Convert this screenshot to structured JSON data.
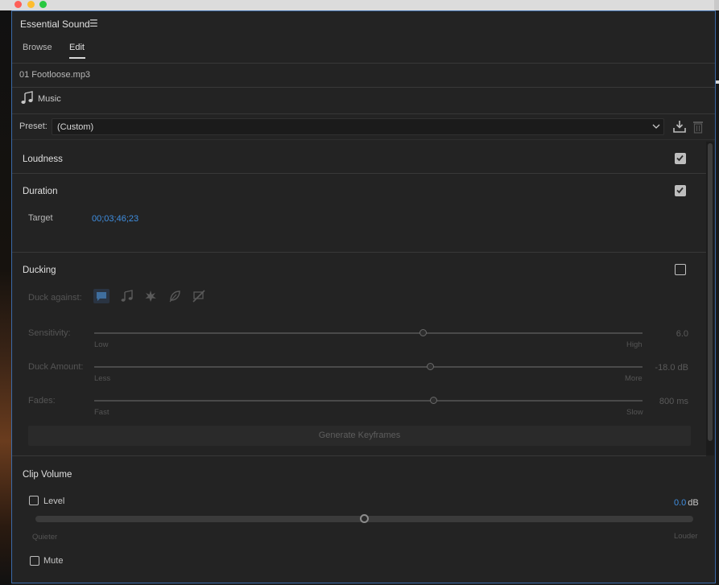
{
  "panel": {
    "title": "Essential Sound",
    "menu_icon": "hamburger-icon"
  },
  "tabs": [
    {
      "label": "Browse"
    },
    {
      "label": "Edit",
      "active": true
    }
  ],
  "clip": {
    "name": "01 Footloose.mp3",
    "type_label": "Music",
    "type_icon": "music-note-icon"
  },
  "preset": {
    "label": "Preset:",
    "value": "(Custom)"
  },
  "sections": {
    "loudness": {
      "title": "Loudness",
      "enabled": true
    },
    "duration": {
      "title": "Duration",
      "enabled": true,
      "target_label": "Target",
      "target_value": "00;03;46;23"
    },
    "ducking": {
      "title": "Ducking",
      "enabled": false,
      "duck_against_label": "Duck against:",
      "duck_against_icons": [
        "dialogue-icon",
        "music-icon",
        "sfx-icon",
        "ambience-icon",
        "no-type-icon"
      ],
      "sensitivity": {
        "label": "Sensitivity:",
        "min_label": "Low",
        "max_label": "High",
        "value": "6.0",
        "position": 0.6
      },
      "duck_amount": {
        "label": "Duck Amount:",
        "min_label": "Less",
        "max_label": "More",
        "value": "-18.0 dB",
        "position": 0.613
      },
      "fades": {
        "label": "Fades:",
        "min_label": "Fast",
        "max_label": "Slow",
        "value": "800 ms",
        "position": 0.619
      },
      "generate_button": "Generate Keyframes"
    },
    "clip_volume": {
      "title": "Clip Volume",
      "level": {
        "label": "Level",
        "checked": false,
        "value": "0.0",
        "unit": "dB",
        "min_label": "Quieter",
        "max_label": "Louder",
        "position": 0.5
      },
      "mute": {
        "label": "Mute",
        "checked": false
      }
    }
  },
  "colors": {
    "accent": "#3f8ee0",
    "panel_bg": "#232323",
    "focus_border": "#3a6aa8"
  }
}
